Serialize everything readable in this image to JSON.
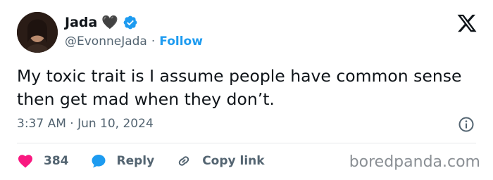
{
  "author": {
    "name": "Jada",
    "emoji": "🖤",
    "handle": "@EvonneJada",
    "separator": "·",
    "follow_label": "Follow",
    "verified": true
  },
  "tweet": {
    "text": "My toxic trait is I assume people have common sense then get mad when they don’t.",
    "timestamp": "3:37 AM · Jun 10, 2024"
  },
  "actions": {
    "likes": "384",
    "reply_label": "Reply",
    "copy_label": "Copy link"
  },
  "watermark": "boredpanda.com",
  "icons": [
    "x-logo-icon",
    "verified-icon",
    "info-icon",
    "heart-icon",
    "reply-icon",
    "link-icon"
  ],
  "colors": {
    "accent": "#1d9bf0",
    "heart": "#f91880",
    "text": "#0f1419",
    "muted": "#536471"
  }
}
